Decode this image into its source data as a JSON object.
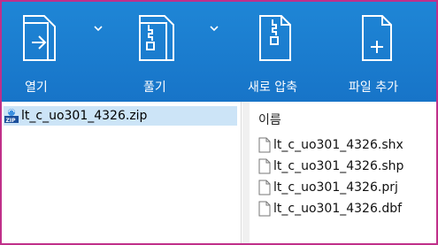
{
  "toolbar": {
    "open_label": "열기",
    "extract_label": "풀기",
    "new_archive_label": "새로 압축",
    "add_file_label": "파일 추가"
  },
  "tree": {
    "archive_name": "lt_c_uo301_4326.zip"
  },
  "file_list": {
    "header_name": "이름",
    "files": [
      "lt_c_uo301_4326.shx",
      "lt_c_uo301_4326.shp",
      "lt_c_uo301_4326.prj",
      "lt_c_uo301_4326.dbf"
    ]
  },
  "colors": {
    "toolbar_blue": "#1a7ccf",
    "selection": "#cce4f7",
    "frame": "#c0308a"
  },
  "icons": {
    "open": "folder-arrow-icon",
    "extract": "folder-zip-icon",
    "new_archive": "zip-file-icon",
    "add_file": "file-plus-icon"
  }
}
